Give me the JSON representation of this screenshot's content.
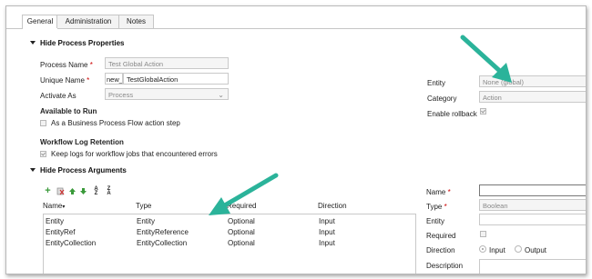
{
  "tabs": [
    "General",
    "Administration",
    "Notes"
  ],
  "properties_section": {
    "title": "Hide Process Properties"
  },
  "process_name": {
    "label": "Process Name",
    "value": "Test Global Action"
  },
  "unique_name": {
    "label": "Unique Name",
    "prefix": "new_",
    "value": "TestGlobalAction"
  },
  "activate_as": {
    "label": "Activate As",
    "value": "Process"
  },
  "available_to_run": {
    "title": "Available to Run",
    "option": "As a Business Process Flow action step"
  },
  "workflow_log": {
    "title": "Workflow Log Retention",
    "option": "Keep logs for workflow jobs that encountered errors"
  },
  "entity": {
    "label": "Entity",
    "value": "None (global)"
  },
  "category": {
    "label": "Category",
    "value": "Action"
  },
  "rollback": {
    "label": "Enable rollback"
  },
  "arguments_section": {
    "title": "Hide Process Arguments"
  },
  "grid": {
    "headers": {
      "name": "Name",
      "type": "Type",
      "required": "Required",
      "direction": "Direction"
    },
    "rows": [
      {
        "name": "Entity",
        "type": "Entity",
        "required": "Optional",
        "direction": "Input"
      },
      {
        "name": "EntityRef",
        "type": "EntityReference",
        "required": "Optional",
        "direction": "Input"
      },
      {
        "name": "EntityCollection",
        "type": "EntityCollection",
        "required": "Optional",
        "direction": "Input"
      }
    ]
  },
  "arg_form": {
    "name_label": "Name",
    "type_label": "Type",
    "type_value": "Boolean",
    "entity_label": "Entity",
    "required_label": "Required",
    "direction_label": "Direction",
    "input_label": "Input",
    "output_label": "Output",
    "description_label": "Description"
  },
  "colors": {
    "arrow": "#2bb39a",
    "required_star": "#cc0000"
  },
  "icons": [
    "add-icon",
    "delete-icon",
    "move-up-icon",
    "move-down-icon",
    "sort-ascending-icon",
    "sort-descending-icon"
  ]
}
